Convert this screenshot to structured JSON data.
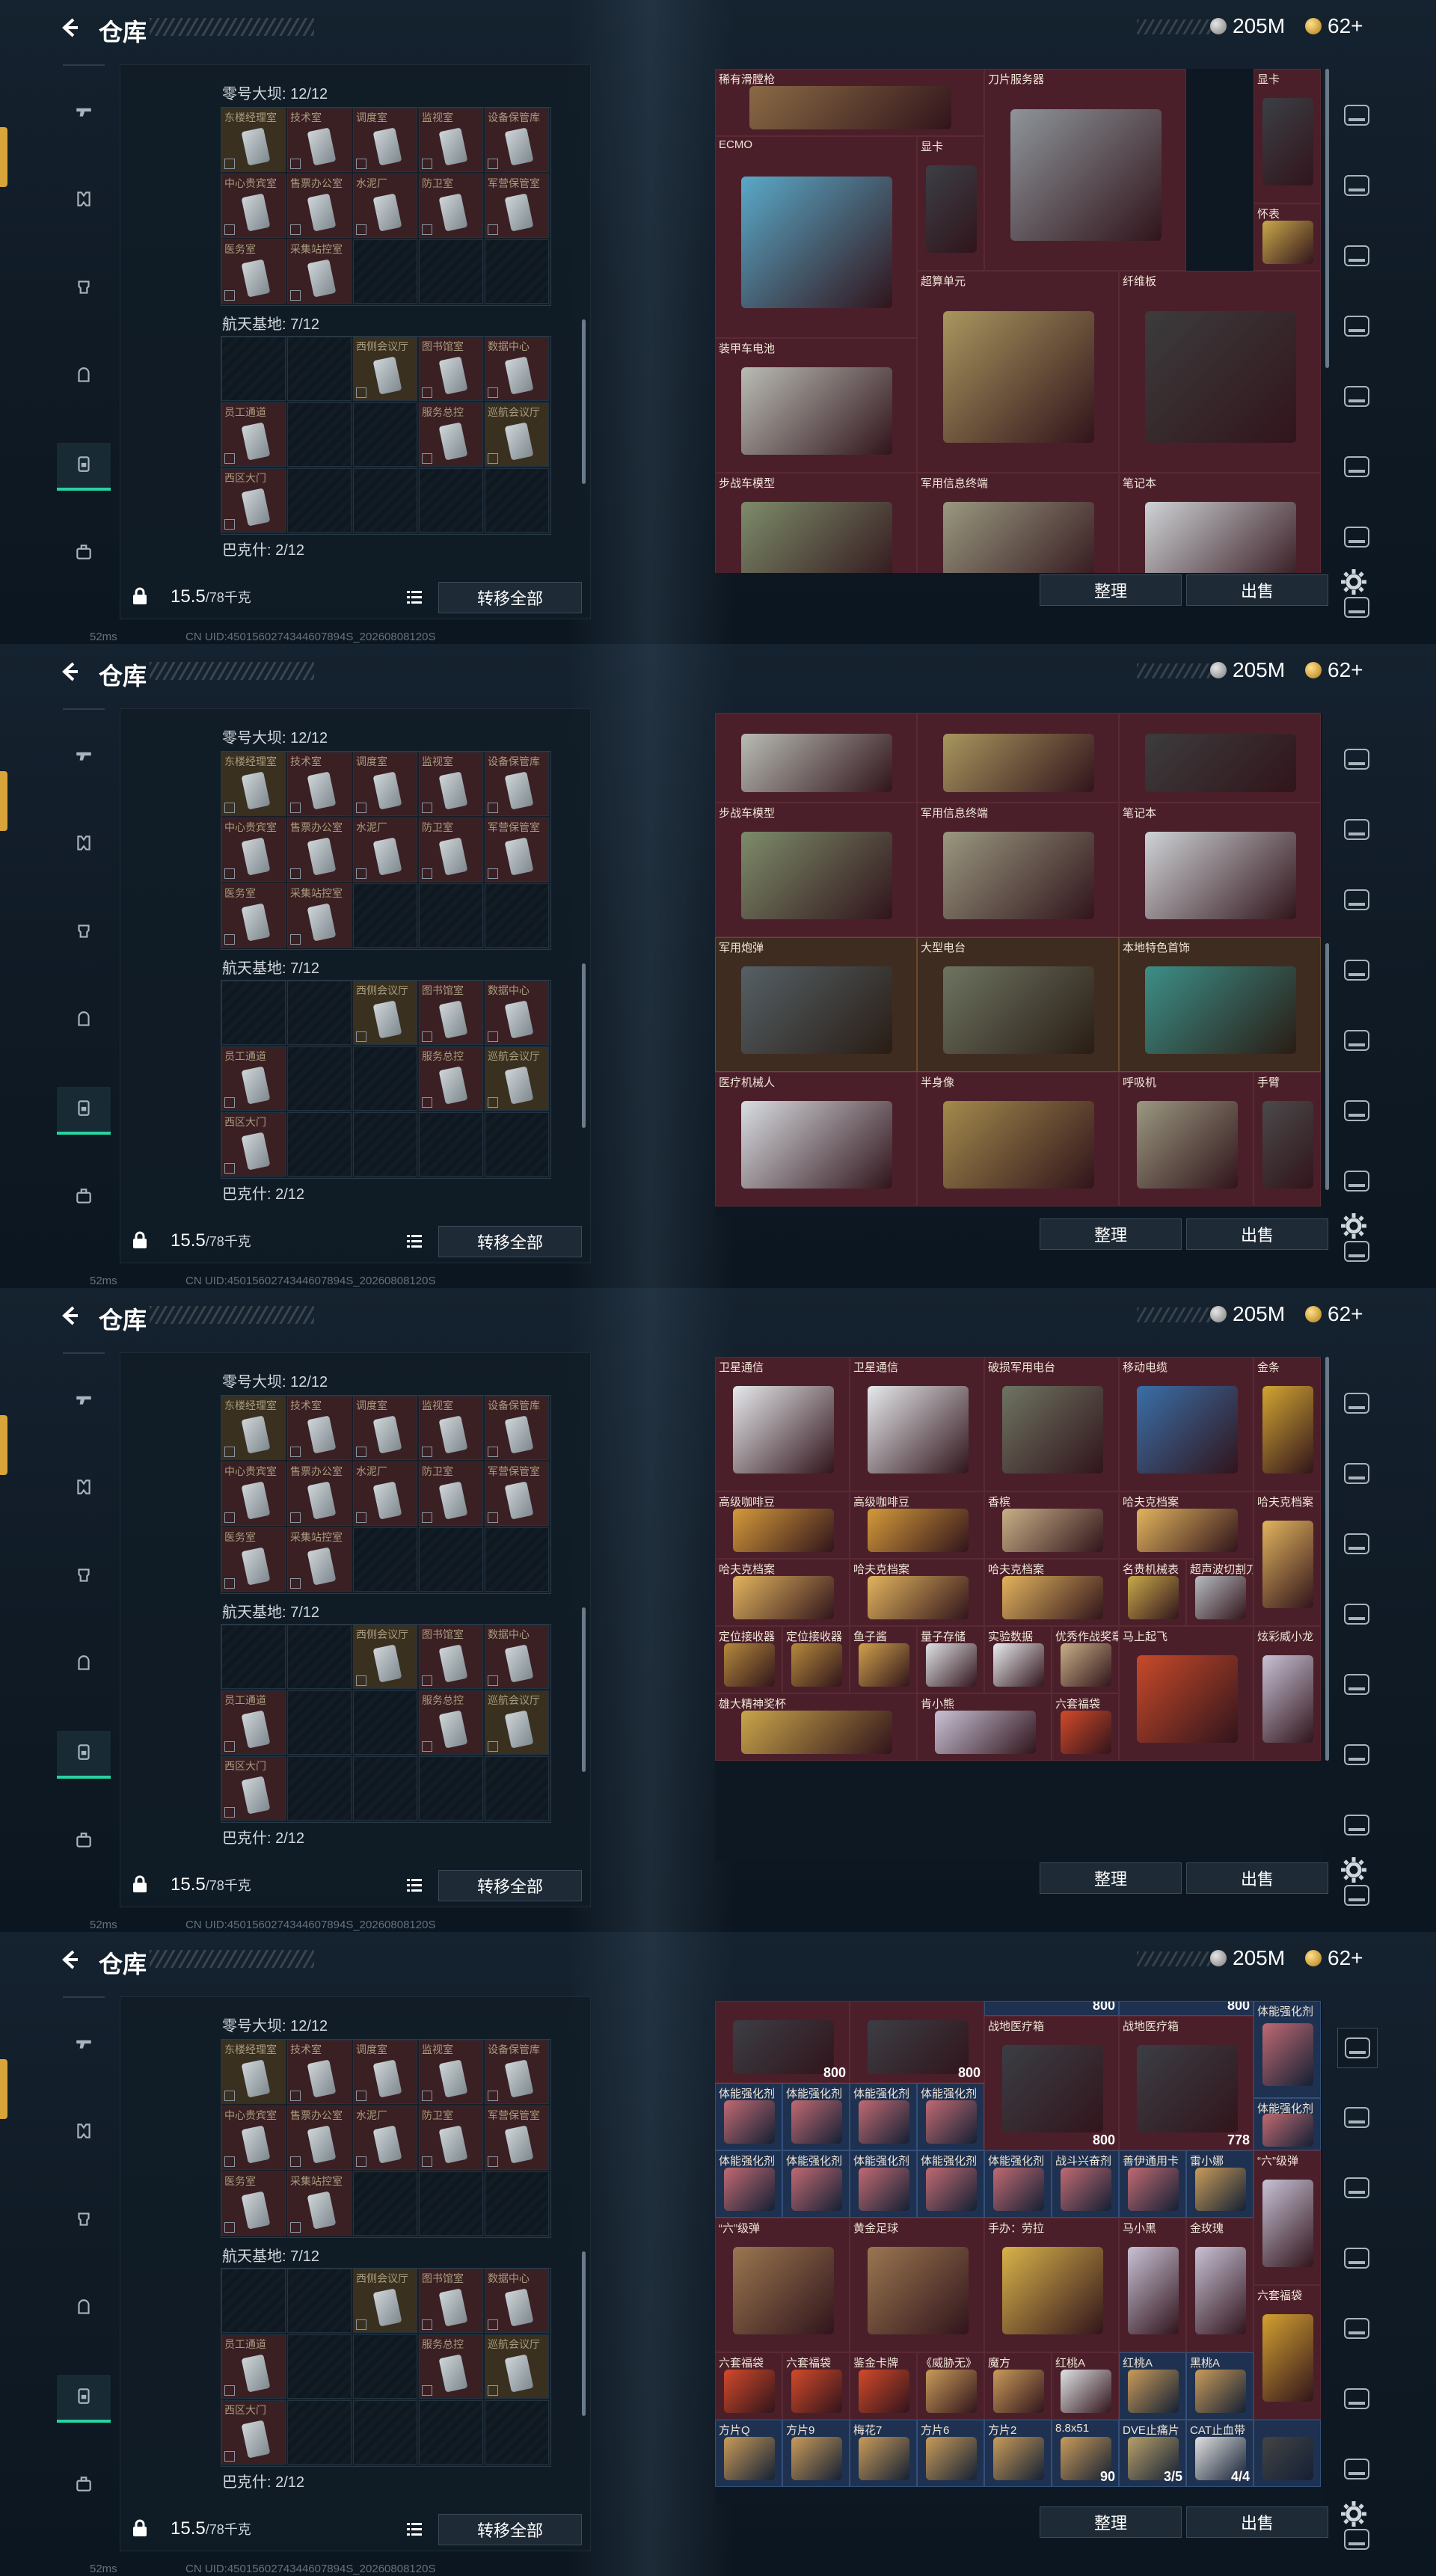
{
  "header": {
    "title": "仓库",
    "silver_amount": "205M",
    "gold_amount": "62+"
  },
  "left_panel": {
    "sections": [
      {
        "title": "零号大坝: 12/12"
      },
      {
        "title": "航天基地: 7/12"
      },
      {
        "title": "巴克什: 2/12"
      }
    ],
    "dam_labels": [
      "东楼经理室",
      "技术室",
      "调度室",
      "监视室",
      "设备保管库",
      "中心贵宾室",
      "售票办公室",
      "水泥厂",
      "防卫室",
      "军营保管室",
      "医务室",
      "采集站控室"
    ],
    "base_labels": [
      "西侧会议厅",
      "图书馆室",
      "数据中心",
      "员工通道",
      "服务总控",
      "巡航会议厅",
      "西区大门"
    ],
    "weight": "15.5",
    "weight_unit": "/78千克",
    "transfer_all": "转移全部",
    "status": {
      "ping": "52ms",
      "uid": "CN UID:4501560274344607894S_20260808120S"
    }
  },
  "buttons": {
    "sort": "整理",
    "sell": "出售"
  },
  "screens": [
    {
      "items": [
        {
          "name": "稀有滑膛枪",
          "qty": ""
        },
        {
          "name": "刀片服务器",
          "qty": ""
        },
        {
          "name": "显卡",
          "qty": ""
        },
        {
          "name": "ECMO",
          "qty": ""
        },
        {
          "name": "显卡",
          "qty": ""
        },
        {
          "name": "怀表",
          "qty": ""
        },
        {
          "name": "超算单元",
          "qty": ""
        },
        {
          "name": "纤维板",
          "qty": ""
        },
        {
          "name": "装甲车电池",
          "qty": ""
        },
        {
          "name": "步战车模型",
          "qty": ""
        },
        {
          "name": "军用信息终端",
          "qty": ""
        },
        {
          "name": "笔记本",
          "qty": ""
        }
      ]
    },
    {
      "items": [
        {
          "name": "",
          "qty": ""
        },
        {
          "name": "",
          "qty": ""
        },
        {
          "name": "",
          "qty": ""
        },
        {
          "name": "步战车模型",
          "qty": ""
        },
        {
          "name": "军用信息终端",
          "qty": ""
        },
        {
          "name": "笔记本",
          "qty": ""
        },
        {
          "name": "军用炮弹",
          "qty": ""
        },
        {
          "name": "大型电台",
          "qty": ""
        },
        {
          "name": "本地特色首饰",
          "qty": ""
        },
        {
          "name": "医疗机械人",
          "qty": ""
        },
        {
          "name": "半身像",
          "qty": ""
        },
        {
          "name": "呼吸机",
          "qty": ""
        },
        {
          "name": "手臂",
          "qty": ""
        }
      ]
    },
    {
      "items": [
        {
          "name": "卫星通信",
          "qty": ""
        },
        {
          "name": "卫星通信",
          "qty": ""
        },
        {
          "name": "破损军用电台",
          "qty": ""
        },
        {
          "name": "移动电缆",
          "qty": ""
        },
        {
          "name": "金条",
          "qty": ""
        },
        {
          "name": "高级咖啡豆",
          "qty": ""
        },
        {
          "name": "高级咖啡豆",
          "qty": ""
        },
        {
          "name": "香槟",
          "qty": ""
        },
        {
          "name": "哈夫克档案",
          "qty": ""
        },
        {
          "name": "哈夫克档案",
          "qty": ""
        },
        {
          "name": "哈夫克档案",
          "qty": ""
        },
        {
          "name": "哈夫克档案",
          "qty": ""
        },
        {
          "name": "哈夫克档案",
          "qty": ""
        },
        {
          "name": "名贵机械表",
          "qty": ""
        },
        {
          "name": "超声波切割刀",
          "qty": ""
        },
        {
          "name": "定位接收器",
          "qty": ""
        },
        {
          "name": "定位接收器",
          "qty": ""
        },
        {
          "name": "鱼子酱",
          "qty": ""
        },
        {
          "name": "量子存储",
          "qty": ""
        },
        {
          "name": "实验数据",
          "qty": ""
        },
        {
          "name": "优秀作战奖章",
          "qty": ""
        },
        {
          "name": "马上起飞",
          "qty": ""
        },
        {
          "name": "炫彩威小龙",
          "qty": ""
        },
        {
          "name": "雄大精神奖杯",
          "qty": ""
        },
        {
          "name": "肯小熊",
          "qty": ""
        },
        {
          "name": "六套福袋",
          "qty": ""
        }
      ]
    },
    {
      "items": [
        {
          "name": "",
          "qty": "800"
        },
        {
          "name": "",
          "qty": "800"
        },
        {
          "name": "",
          "qty": "800"
        },
        {
          "name": "",
          "qty": "800"
        },
        {
          "name": "战地医疗箱",
          "qty": "800"
        },
        {
          "name": "战地医疗箱",
          "qty": "778"
        },
        {
          "name": "体能强化剂",
          "qty": ""
        },
        {
          "name": "体能强化剂",
          "qty": ""
        },
        {
          "name": "体能强化剂",
          "qty": ""
        },
        {
          "name": "体能强化剂",
          "qty": ""
        },
        {
          "name": "体能强化剂",
          "qty": ""
        },
        {
          "name": "体能强化剂",
          "qty": ""
        },
        {
          "name": "体能强化剂",
          "qty": ""
        },
        {
          "name": "体能强化剂",
          "qty": ""
        },
        {
          "name": "体能强化剂",
          "qty": ""
        },
        {
          "name": "体能强化剂",
          "qty": ""
        },
        {
          "name": "体能强化剂",
          "qty": ""
        },
        {
          "name": "战斗兴奋剂",
          "qty": ""
        },
        {
          "name": "善伊通用卡",
          "qty": ""
        },
        {
          "name": "雷小娜",
          "qty": ""
        },
        {
          "name": "“六”级弹",
          "qty": ""
        },
        {
          "name": "“六”级弹",
          "qty": ""
        },
        {
          "name": "黄金足球",
          "qty": ""
        },
        {
          "name": "手办：劳拉",
          "qty": ""
        },
        {
          "name": "马小黑",
          "qty": ""
        },
        {
          "name": "金玫瑰",
          "qty": ""
        },
        {
          "name": "六套福袋",
          "qty": ""
        },
        {
          "name": "六套福袋",
          "qty": ""
        },
        {
          "name": "六套福袋",
          "qty": ""
        },
        {
          "name": "鉴金卡牌",
          "qty": ""
        },
        {
          "name": "《威胁无》",
          "qty": ""
        },
        {
          "name": "魔方",
          "qty": ""
        },
        {
          "name": "红桃A",
          "qty": ""
        },
        {
          "name": "红桃A",
          "qty": ""
        },
        {
          "name": "黑桃A",
          "qty": ""
        },
        {
          "name": "方片Q",
          "qty": ""
        },
        {
          "name": "方片9",
          "qty": ""
        },
        {
          "name": "梅花7",
          "qty": ""
        },
        {
          "name": "方片6",
          "qty": ""
        },
        {
          "name": "方片2",
          "qty": ""
        },
        {
          "name": "8.8x51",
          "qty": "90"
        },
        {
          "name": "DVE止痛片",
          "qty": "3/5"
        },
        {
          "name": "CAT止血带",
          "qty": "4/4"
        }
      ]
    }
  ],
  "colors": {
    "accent": "#27d3a2",
    "item_red": "#4b1f2a",
    "item_brown": "#3f2c20",
    "item_blue": "#1e3150"
  },
  "icons": {
    "back": "chevron-left-icon",
    "lock": "lock-icon",
    "list": "list-icon",
    "settings": "gear-icon"
  }
}
